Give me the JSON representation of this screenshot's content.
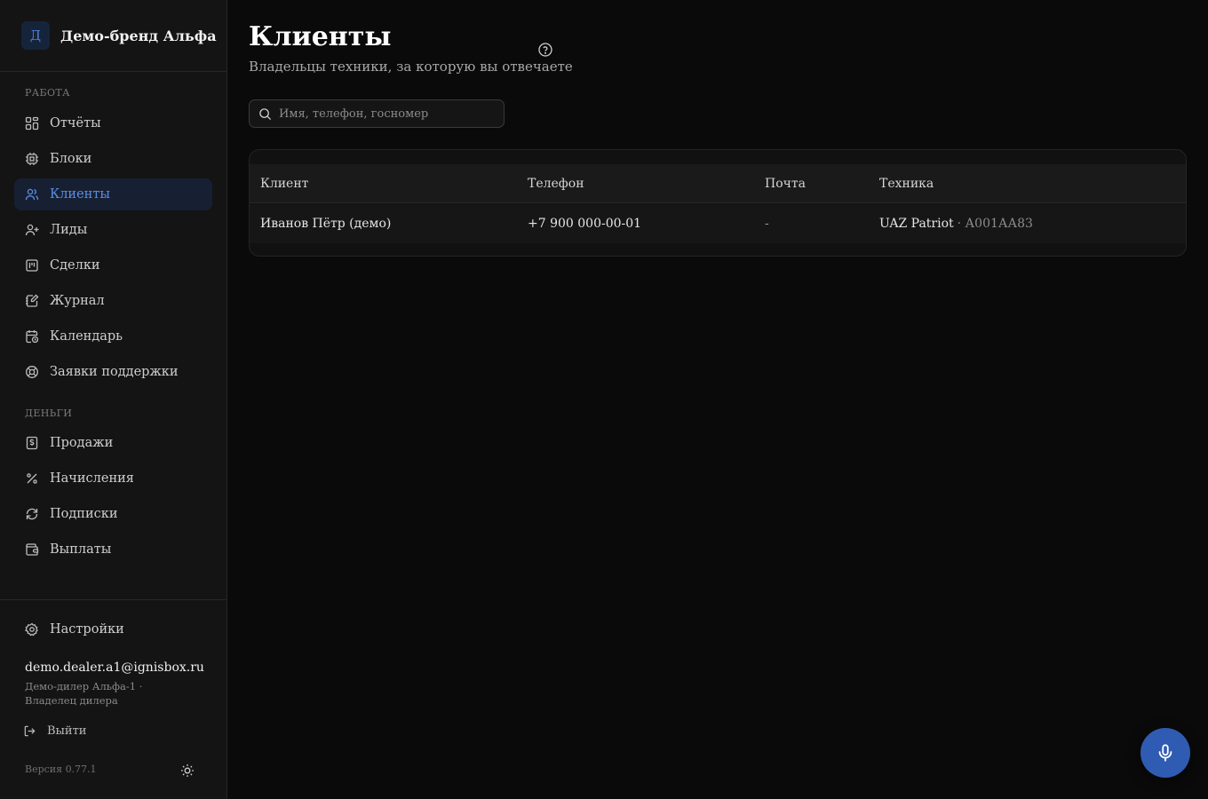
{
  "brand": {
    "initial": "Д",
    "name": "Демо-бренд Альфа"
  },
  "sidebar": {
    "section_work": "Работа",
    "section_money": "Деньги",
    "work_items": [
      {
        "label": "Отчёты",
        "icon": "dashboard-icon"
      },
      {
        "label": "Блоки",
        "icon": "chip-icon"
      },
      {
        "label": "Клиенты",
        "icon": "users-icon",
        "active": true
      },
      {
        "label": "Лиды",
        "icon": "user-plus-icon"
      },
      {
        "label": "Сделки",
        "icon": "kanban-icon"
      },
      {
        "label": "Журнал",
        "icon": "notebook-pen-icon"
      },
      {
        "label": "Календарь",
        "icon": "calendar-clock-icon"
      },
      {
        "label": "Заявки поддержки",
        "icon": "life-buoy-icon"
      }
    ],
    "money_items": [
      {
        "label": "Продажи",
        "icon": "receipt-dollar-icon"
      },
      {
        "label": "Начисления",
        "icon": "percent-icon"
      },
      {
        "label": "Подписки",
        "icon": "refresh-icon"
      },
      {
        "label": "Выплаты",
        "icon": "wallet-icon"
      }
    ],
    "settings_label": "Настройки",
    "user_email": "demo.dealer.a1@ignisbox.ru",
    "user_role": "Демо-дилер Альфа-1 · Владелец дилера",
    "logout_label": "Выйти",
    "version": "Версия 0.77.1"
  },
  "page": {
    "title": "Клиенты",
    "subtitle": "Владельцы техники, за которую вы отвечаете"
  },
  "search": {
    "placeholder": "Имя, телефон, госномер",
    "value": ""
  },
  "table": {
    "columns": [
      "Клиент",
      "Телефон",
      "Почта",
      "Техника"
    ],
    "rows": [
      {
        "client": "Иванов Пётр (демо)",
        "phone": "+7 900 000-00-01",
        "email": "-",
        "vehicle_model": "UAZ Patriot",
        "vehicle_plate": "· А001АА83"
      }
    ]
  },
  "colors": {
    "accent": "#5b8ee6",
    "active_bg": "#172033",
    "mic_button": "#2f5bb3",
    "background": "#0a0a0a",
    "sidebar": "#141414"
  }
}
